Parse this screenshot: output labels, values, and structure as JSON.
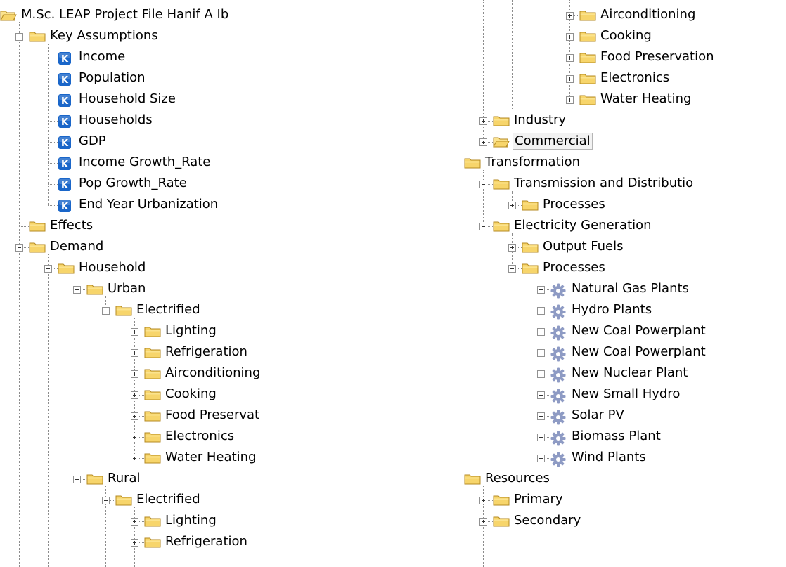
{
  "left_tree": [
    {
      "label": "M.Sc. LEAP Project File Hanif A Ib",
      "icon": "folder-open-icon",
      "level": 0,
      "expander": "none"
    },
    {
      "label": "Key Assumptions",
      "icon": "folder-icon",
      "level": 1,
      "expander": "minus"
    },
    {
      "label": "Income",
      "icon": "key-assumption-icon",
      "level": 2,
      "expander": "none"
    },
    {
      "label": "Population",
      "icon": "key-assumption-icon",
      "level": 2,
      "expander": "none"
    },
    {
      "label": "Household Size",
      "icon": "key-assumption-icon",
      "level": 2,
      "expander": "none"
    },
    {
      "label": "Households",
      "icon": "key-assumption-icon",
      "level": 2,
      "expander": "none"
    },
    {
      "label": "GDP",
      "icon": "key-assumption-icon",
      "level": 2,
      "expander": "none"
    },
    {
      "label": "Income Growth_Rate",
      "icon": "key-assumption-icon",
      "level": 2,
      "expander": "none"
    },
    {
      "label": "Pop Growth_Rate",
      "icon": "key-assumption-icon",
      "level": 2,
      "expander": "none"
    },
    {
      "label": "End Year Urbanization",
      "icon": "key-assumption-icon",
      "level": 2,
      "expander": "none"
    },
    {
      "label": "Effects",
      "icon": "folder-icon",
      "level": 1,
      "expander": "none"
    },
    {
      "label": "Demand",
      "icon": "folder-icon",
      "level": 1,
      "expander": "minus"
    },
    {
      "label": "Household",
      "icon": "folder-icon",
      "level": 2,
      "expander": "minus"
    },
    {
      "label": "Urban",
      "icon": "folder-icon",
      "level": 3,
      "expander": "minus"
    },
    {
      "label": "Electrified",
      "icon": "folder-icon",
      "level": 4,
      "expander": "minus"
    },
    {
      "label": "Lighting",
      "icon": "folder-icon",
      "level": 5,
      "expander": "plus"
    },
    {
      "label": "Refrigeration",
      "icon": "folder-icon",
      "level": 5,
      "expander": "plus"
    },
    {
      "label": "Airconditioning",
      "icon": "folder-icon",
      "level": 5,
      "expander": "plus"
    },
    {
      "label": "Cooking",
      "icon": "folder-icon",
      "level": 5,
      "expander": "plus"
    },
    {
      "label": "Food Preservat",
      "icon": "folder-icon",
      "level": 5,
      "expander": "plus"
    },
    {
      "label": "Electronics",
      "icon": "folder-icon",
      "level": 5,
      "expander": "plus"
    },
    {
      "label": "Water Heating",
      "icon": "folder-icon",
      "level": 5,
      "expander": "plus"
    },
    {
      "label": "Rural",
      "icon": "folder-icon",
      "level": 3,
      "expander": "minus"
    },
    {
      "label": "Electrified",
      "icon": "folder-icon",
      "level": 4,
      "expander": "minus"
    },
    {
      "label": "Lighting",
      "icon": "folder-icon",
      "level": 5,
      "expander": "plus"
    },
    {
      "label": "Refrigeration",
      "icon": "folder-icon",
      "level": 5,
      "expander": "plus"
    }
  ],
  "right_tree": [
    {
      "label": "Airconditioning",
      "icon": "folder-icon",
      "level": 4,
      "expander": "plus"
    },
    {
      "label": "Cooking",
      "icon": "folder-icon",
      "level": 4,
      "expander": "plus"
    },
    {
      "label": "Food Preservation",
      "icon": "folder-icon",
      "level": 4,
      "expander": "plus"
    },
    {
      "label": "Electronics",
      "icon": "folder-icon",
      "level": 4,
      "expander": "plus"
    },
    {
      "label": "Water Heating",
      "icon": "folder-icon",
      "level": 4,
      "expander": "plus"
    },
    {
      "label": "Industry",
      "icon": "folder-icon",
      "level": 1,
      "expander": "plus"
    },
    {
      "label": "Commercial",
      "icon": "folder-open-icon",
      "level": 1,
      "expander": "plus",
      "selected": true
    },
    {
      "label": "Transformation",
      "icon": "folder-icon",
      "level": 0,
      "expander": "none"
    },
    {
      "label": "Transmission and Distributio",
      "icon": "folder-icon",
      "level": 1,
      "expander": "minus"
    },
    {
      "label": "Processes",
      "icon": "folder-icon",
      "level": 2,
      "expander": "plus"
    },
    {
      "label": "Electricity Generation",
      "icon": "folder-icon",
      "level": 1,
      "expander": "minus"
    },
    {
      "label": "Output Fuels",
      "icon": "folder-icon",
      "level": 2,
      "expander": "plus"
    },
    {
      "label": "Processes",
      "icon": "folder-icon",
      "level": 2,
      "expander": "minus"
    },
    {
      "label": "Natural Gas Plants",
      "icon": "process-gear-icon",
      "level": 3,
      "expander": "plus"
    },
    {
      "label": "Hydro Plants",
      "icon": "process-gear-icon",
      "level": 3,
      "expander": "plus"
    },
    {
      "label": "New Coal Powerplant",
      "icon": "process-gear-icon",
      "level": 3,
      "expander": "plus"
    },
    {
      "label": "New Coal Powerplant",
      "icon": "process-gear-icon",
      "level": 3,
      "expander": "plus"
    },
    {
      "label": "New Nuclear Plant",
      "icon": "process-gear-icon",
      "level": 3,
      "expander": "plus"
    },
    {
      "label": "New Small Hydro",
      "icon": "process-gear-icon",
      "level": 3,
      "expander": "plus"
    },
    {
      "label": "Solar PV",
      "icon": "process-gear-icon",
      "level": 3,
      "expander": "plus"
    },
    {
      "label": "Biomass Plant",
      "icon": "process-gear-icon",
      "level": 3,
      "expander": "plus"
    },
    {
      "label": "Wind Plants",
      "icon": "process-gear-icon",
      "level": 3,
      "expander": "plus"
    },
    {
      "label": "Resources",
      "icon": "folder-icon",
      "level": 0,
      "expander": "none"
    },
    {
      "label": "Primary",
      "icon": "folder-icon",
      "level": 1,
      "expander": "plus"
    },
    {
      "label": "Secondary",
      "icon": "folder-icon",
      "level": 1,
      "expander": "plus"
    }
  ],
  "colors": {
    "folder_fill": "#f7d56b",
    "folder_tab": "#fbe38e",
    "folder_outline": "#b48a21",
    "key_badge": "#1a66c9",
    "gear": "#8e9bc4"
  }
}
